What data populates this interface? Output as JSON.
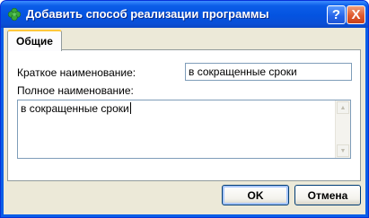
{
  "window": {
    "title": "Добавить способ реализации программы"
  },
  "tabs": [
    {
      "label": "Общие"
    }
  ],
  "form": {
    "short_name_label": "Краткое наименование:",
    "short_name_value": "в сокращенные сроки",
    "full_name_label": "Полное наименование:",
    "full_name_value": "в сокращенные сроки"
  },
  "buttons": {
    "ok": "OK",
    "cancel": "Отмена",
    "help": "?",
    "close": "X"
  },
  "icons": {
    "app": "clover-icon",
    "help": "help-icon",
    "close": "close-icon"
  },
  "colors": {
    "titlebar": "#0453e0",
    "dialog_bg": "#ece9d8",
    "tab_highlight": "#ffc83c",
    "close_button": "#e05a2e"
  }
}
